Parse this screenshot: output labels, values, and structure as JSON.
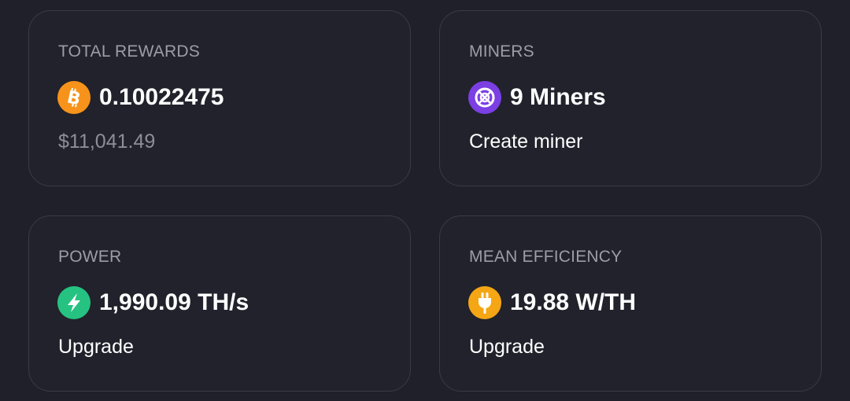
{
  "colors": {
    "background": "#1f2029",
    "card_border": "#3a3b44",
    "bitcoin": "#f7931a",
    "miners": "#7b3fe4",
    "power": "#26c281",
    "efficiency": "#f5a614"
  },
  "cards": {
    "total_rewards": {
      "title": "TOTAL REWARDS",
      "icon": "bitcoin-icon",
      "value": "0.10022475",
      "sub": "$11,041.49"
    },
    "miners": {
      "title": "MINERS",
      "icon": "miner-icon",
      "value": "9 Miners",
      "action": "Create miner"
    },
    "power": {
      "title": "POWER",
      "icon": "lightning-icon",
      "value": "1,990.09 TH/s",
      "action": "Upgrade"
    },
    "mean_efficiency": {
      "title": "MEAN EFFICIENCY",
      "icon": "plug-icon",
      "value": "19.88 W/TH",
      "action": "Upgrade"
    }
  }
}
